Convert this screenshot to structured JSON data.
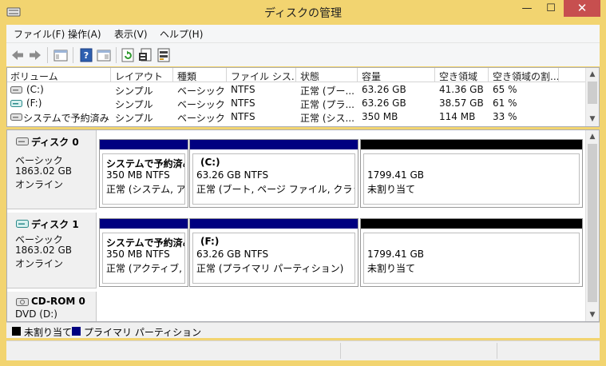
{
  "window": {
    "title": "ディスクの管理",
    "minimize": "—",
    "maximize": "☐",
    "close": "✕"
  },
  "menu": [
    {
      "label": "ファイル(F)"
    },
    {
      "label": "操作(A)"
    },
    {
      "label": "表示(V)"
    },
    {
      "label": "ヘルプ(H)"
    }
  ],
  "toolbar": [
    "back-icon",
    "forward-icon",
    "show-hide-console-tree-icon",
    "help-icon",
    "properties-pane-icon",
    "refresh-icon",
    "properties-icon",
    "rescan-disks-icon"
  ],
  "volume_list": {
    "columns": [
      "ボリューム",
      "レイアウト",
      "種類",
      "ファイル シス...",
      "状態",
      "容量",
      "空き領域",
      "空き領域の割..."
    ],
    "rows": [
      {
        "volume": "(C:)",
        "layout": "シンプル",
        "type": "ベーシック",
        "fs": "NTFS",
        "status": "正常 (ブー...",
        "capacity": "63.26 GB",
        "free": "41.36 GB",
        "pct": "65 %"
      },
      {
        "volume": "(F:)",
        "layout": "シンプル",
        "type": "ベーシック",
        "fs": "NTFS",
        "status": "正常 (プラ...",
        "capacity": "63.26 GB",
        "free": "38.57 GB",
        "pct": "61 %"
      },
      {
        "volume": "システムで予約済み",
        "layout": "シンプル",
        "type": "ベーシック",
        "fs": "NTFS",
        "status": "正常 (シス...",
        "capacity": "350 MB",
        "free": "114 MB",
        "pct": "33 %"
      }
    ]
  },
  "disks": [
    {
      "name": "ディスク 0",
      "kind": "ベーシック",
      "size": "1863.02 GB",
      "state": "オンライン",
      "partitions": [
        {
          "title": "システムで予約済み",
          "fs": "350 MB NTFS",
          "status": "正常 (システム, アク"
        },
        {
          "title": "(C:)",
          "fs": "63.26 GB NTFS",
          "status": "正常 (ブート, ページ ファイル, クラッシュ ダ"
        },
        {
          "title": "",
          "fs": "1799.41 GB",
          "status": "未割り当て"
        }
      ]
    },
    {
      "name": "ディスク 1",
      "kind": "ベーシック",
      "size": "1863.02 GB",
      "state": "オンライン",
      "partitions": [
        {
          "title": "システムで予約済み",
          "fs": "350 MB NTFS",
          "status": "正常 (アクティブ, プラ"
        },
        {
          "title": "(F:)",
          "fs": "63.26 GB NTFS",
          "status": "正常 (プライマリ パーティション)"
        },
        {
          "title": "",
          "fs": "1799.41 GB",
          "status": "未割り当て"
        }
      ]
    },
    {
      "name": "CD-ROM 0",
      "kind": "DVD (D:)"
    }
  ],
  "legend": [
    {
      "label": "未割り当て",
      "color": "#000000"
    },
    {
      "label": "プライマリ パーティション",
      "color": "#000080"
    }
  ],
  "colors": {
    "frame": "#f2d470",
    "primary": "#000080",
    "unallocated": "#000000"
  }
}
